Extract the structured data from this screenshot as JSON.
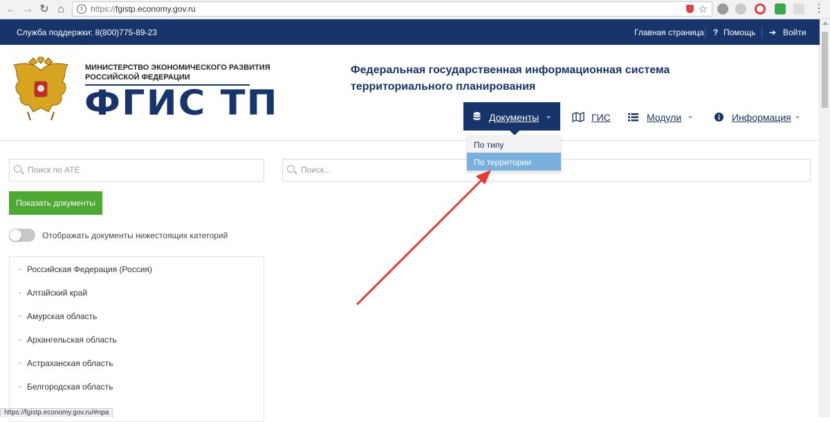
{
  "browser": {
    "url_protocol": "https://",
    "url_host": "fgistp.economy.gov.ru",
    "status_url": "https://fgistp.economy.gov.ru/#npa"
  },
  "topbar": {
    "support": "Служба поддержки: 8(800)775-89-23",
    "home": "Главная страница",
    "help": "Помощь",
    "login": "Войти"
  },
  "header": {
    "ministry_line1": "МИНИСТЕРСТВО ЭКОНОМИЧЕСКОГО РАЗВИТИЯ",
    "ministry_line2": "РОССИЙСКОЙ ФЕДЕРАЦИИ",
    "logo_text": "ФГИС ТП",
    "system_title": "Федеральная государственная информационная система территориального планирования"
  },
  "nav": {
    "documents": "Документы",
    "gis": "ГИС",
    "modules": "Модули",
    "info": "Информация"
  },
  "dropdown": {
    "items": [
      "По типу",
      "По территории"
    ],
    "active_index": 1
  },
  "search": {
    "ate_placeholder": "Поиск по АТЕ",
    "main_placeholder": "Поиск..."
  },
  "sidebar": {
    "show_button": "Показать документы",
    "toggle_label": "Отображать документы нижестоящих категорий",
    "toggle_on": false,
    "regions": [
      "Российская Федерация (Россия)",
      "Алтайский край",
      "Амурская область",
      "Архангельская область",
      "Астраханская область",
      "Белгородская область"
    ]
  },
  "colors": {
    "brand": "#17356b",
    "button_green": "#4caa32",
    "dropdown_active": "#7ab0dd",
    "arrow": "#e53935"
  }
}
